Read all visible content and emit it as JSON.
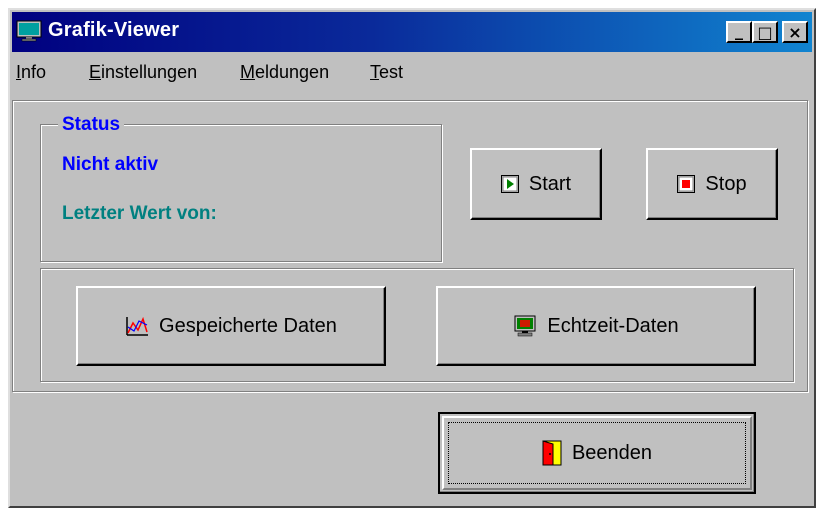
{
  "window": {
    "title": "Grafik-Viewer",
    "controls": {
      "minimize": "_",
      "maximize": "□",
      "close": "×"
    }
  },
  "menu": {
    "items": [
      {
        "label": "Info",
        "accel": "I",
        "rest": "nfo"
      },
      {
        "label": "Einstellungen",
        "accel": "E",
        "rest": "instellungen"
      },
      {
        "label": "Meldungen",
        "accel": "M",
        "rest": "eldungen"
      },
      {
        "label": "Test",
        "accel": "T",
        "rest": "est"
      }
    ]
  },
  "status": {
    "legend": "Status",
    "state": "Nicht aktiv",
    "last_value": "Letzter Wert von:"
  },
  "buttons": {
    "start": "Start",
    "stop": "Stop",
    "saved_data": "Gespeicherte Daten",
    "realtime_data": "Echtzeit-Daten",
    "exit": "Beenden"
  },
  "colors": {
    "status_blue": "#0000ff",
    "last_value_teal": "#008080",
    "window_face": "#c0c0c0",
    "title_start": "#000080",
    "title_end": "#1084d0"
  }
}
